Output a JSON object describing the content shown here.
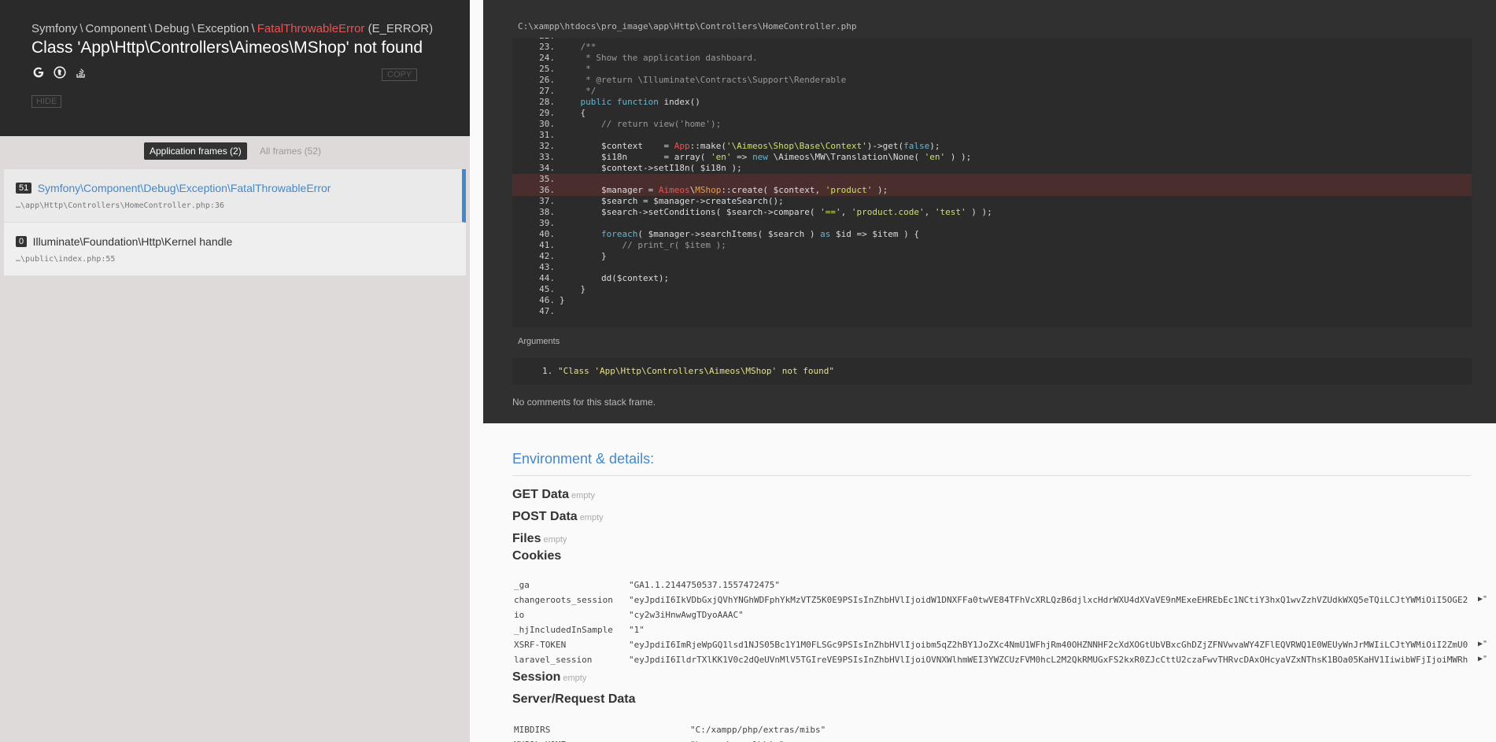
{
  "exception": {
    "path_parts": [
      "Symfony",
      "Component",
      "Debug",
      "Exception"
    ],
    "class": "FatalThrowableError",
    "type": "(E_ERROR)",
    "message": "Class 'App\\Http\\Controllers\\Aimeos\\MShop' not found",
    "copy_label": "COPY",
    "hide_label": "HIDE"
  },
  "search_icons": [
    "google-icon",
    "duckduckgo-icon",
    "stackoverflow-icon"
  ],
  "tabs": {
    "application": "Application frames (2)",
    "all": "All frames (52)"
  },
  "frames": [
    {
      "num": "51",
      "class": "Symfony\\Component\\Debug\\Exception\\FatalThrowableError",
      "file": "…\\app\\Http\\Controllers\\HomeController.php:36",
      "active": true
    },
    {
      "num": "0",
      "class": "Illuminate\\Foundation\\Http\\Kernel handle",
      "file": "…\\public\\index.php:55",
      "active": false
    }
  ],
  "code": {
    "file_path": "C:\\xampp\\htdocs\\pro_image\\app\\Http\\Controllers\\HomeController.php",
    "first_line_number": 22,
    "highlight_lines": [
      35,
      36
    ],
    "lines": [
      "",
      "    /**",
      "     * Show the application dashboard.",
      "     *",
      "     * @return \\Illuminate\\Contracts\\Support\\Renderable",
      "     */",
      "    public function index()",
      "    {",
      "        // return view('home');",
      "",
      "        $context    = App::make('\\Aimeos\\Shop\\Base\\Context')->get(false);",
      "        $i18n       = array( 'en' => new \\Aimeos\\MW\\Translation\\None( 'en' ) );",
      "        $context->setI18n( $i18n );",
      "",
      "        $manager = Aimeos\\MShop::create( $context, 'product' );",
      "        $search = $manager->createSearch();",
      "        $search->setConditions( $search->compare( '==', 'product.code', 'test' ) );",
      "",
      "        foreach( $manager->searchItems( $search ) as $id => $item ) {",
      "            // print_r( $item );",
      "        }",
      "",
      "        dd($context);",
      "    }",
      "}",
      ""
    ]
  },
  "arguments": {
    "title": "Arguments",
    "items": [
      "\"Class 'App\\Http\\Controllers\\Aimeos\\MShop' not found\""
    ]
  },
  "no_comments": "No comments for this stack frame.",
  "env": {
    "title": "Environment & details:",
    "empty_label": "empty",
    "sections": {
      "get": "GET Data",
      "post": "POST Data",
      "files": "Files",
      "cookies": "Cookies",
      "session": "Session",
      "server": "Server/Request Data"
    },
    "cookies": [
      {
        "key": "_ga",
        "value": "\"GA1.1.2144750537.1557472475\"",
        "expand": false
      },
      {
        "key": "changeroots_session",
        "value": "\"eyJpdiI6IkVDbGxjQVhYNGhWDFphYkMzVTZ5K0E9PSIsInZhbHVlIjoidW1DNXFFa0twVE84TFhVcXRLQzB6djlxcHdrWXU4dXVaVE9nMExeEHREbEc1NCtiY3hxQ1wvZzhVZUdkWXQ5eTQiLCJtYWMiOiI5OGE2",
        "expand": true
      },
      {
        "key": "io",
        "value": "\"cy2w3iHnwAwgTDyoAAAC\"",
        "expand": false
      },
      {
        "key": "_hjIncludedInSample",
        "value": "\"1\"",
        "expand": false
      },
      {
        "key": "XSRF-TOKEN",
        "value": "\"eyJpdiI6ImRjeWpGQ1lsd1NJS05Bc1Y1M0FLSGc9PSIsInZhbHVlIjoibm5qZ2hBY1JoZXc4NmU1WFhjRm40OHZNNHF2cXdXOGtUbVBxcGhDZjZFNVwvaWY4ZFlEQVRWQ1E0WEUyWnJrMWIiLCJtYWMiOiI2ZmU0",
        "expand": true
      },
      {
        "key": "laravel_session",
        "value": "\"eyJpdiI6IldrTXlKK1V0c2dQeUVnMlV5TGIreVE9PSIsInZhbHVlIjoiOVNXWlhmWEI3YWZCUzFVM0hcL2M2QkRMUGxFS2kxR0ZJcCttU2czaFwvTHRvcDAxOHcyaVZxNThsK1BOa05KaHV1IiwibWFjIjoiMWRh",
        "expand": true
      }
    ],
    "server": [
      {
        "key": "MIBDIRS",
        "value": "\"C:/xampp/php/extras/mibs\""
      },
      {
        "key": "MYSQL_HOME",
        "value": "\"\\xampp\\mysql\\bin\""
      }
    ],
    "expand_glyph": "▶\""
  },
  "colors": {
    "accent": "#4288ce",
    "error": "#e95353",
    "dark_bg": "#2a2a2a"
  }
}
